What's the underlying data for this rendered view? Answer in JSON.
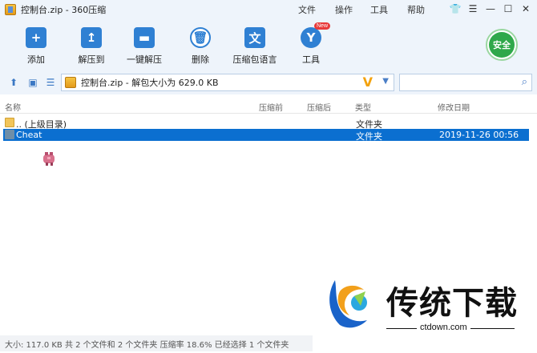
{
  "window": {
    "title": "控制台.zip - 360压缩"
  },
  "menu": [
    "文件",
    "操作",
    "工具",
    "帮助"
  ],
  "toolbar": {
    "buttons": [
      {
        "label": "添加",
        "icon": "plus-icon"
      },
      {
        "label": "解压到",
        "icon": "extract-icon"
      },
      {
        "label": "一键解压",
        "icon": "one-click-extract-icon"
      },
      {
        "label": "删除",
        "icon": "trash-icon"
      },
      {
        "label": "压缩包语言",
        "icon": "language-icon"
      },
      {
        "label": "工具",
        "icon": "tools-icon"
      }
    ],
    "new_badge": "New",
    "safe_label": "安全"
  },
  "address": {
    "path": "控制台.zip - 解包大小为 629.0 KB"
  },
  "columns": [
    "名称",
    "压缩前",
    "压缩后",
    "类型",
    "修改日期"
  ],
  "files": [
    {
      "name": ".. (上级目录)",
      "type": "文件夹",
      "date": ""
    },
    {
      "name": "Cheat",
      "type": "文件夹",
      "date": "2019-11-26 00:56"
    }
  ],
  "status": {
    "text": "大小: 117.0 KB 共 2 个文件和 2 个文件夹 压缩率 18.6% 已经选择 1 个文件夹"
  },
  "watermark": {
    "brand": "传统下载",
    "url": "ctdown.com"
  },
  "colors": {
    "accent": "#2f80d3",
    "selection": "#0b6fd0",
    "safe": "#2fa84a"
  }
}
